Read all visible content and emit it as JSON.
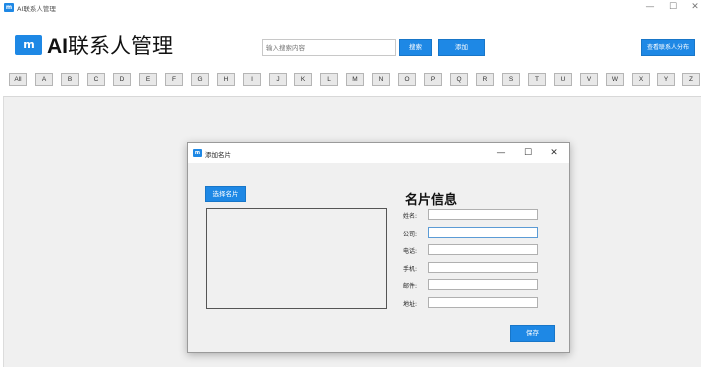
{
  "window": {
    "title": "AI联系人管理",
    "icon_text": "m"
  },
  "window_controls": {
    "minimize": "—",
    "maximize": "☐",
    "close": "✕"
  },
  "brand": {
    "logo_text": "m",
    "name_ai": "AI",
    "name_rest": "联系人管理"
  },
  "search": {
    "placeholder": "输入搜索内容",
    "value": ""
  },
  "buttons": {
    "search": "搜索",
    "add": "添加",
    "distribution": "查看联系人分布"
  },
  "alphabet": [
    "All",
    "A",
    "B",
    "C",
    "D",
    "E",
    "F",
    "G",
    "H",
    "I",
    "J",
    "K",
    "L",
    "M",
    "N",
    "O",
    "P",
    "Q",
    "R",
    "S",
    "T",
    "U",
    "V",
    "W",
    "X",
    "Y",
    "Z"
  ],
  "dialog": {
    "title": "添加名片",
    "icon_text": "m",
    "controls": {
      "minimize": "—",
      "maximize": "☐",
      "close": "✕"
    },
    "choose_card": "选择名片",
    "heading": "名片信息",
    "fields": [
      {
        "label": "姓名:",
        "value": ""
      },
      {
        "label": "公司:",
        "value": ""
      },
      {
        "label": "电话:",
        "value": ""
      },
      {
        "label": "手机:",
        "value": ""
      },
      {
        "label": "邮件:",
        "value": ""
      },
      {
        "label": "地址:",
        "value": ""
      }
    ],
    "save": "保存"
  },
  "colors": {
    "accent": "#1e88e5",
    "content_bg": "#f0f0f0",
    "alpha_button_bg": "#e8e8e8"
  }
}
